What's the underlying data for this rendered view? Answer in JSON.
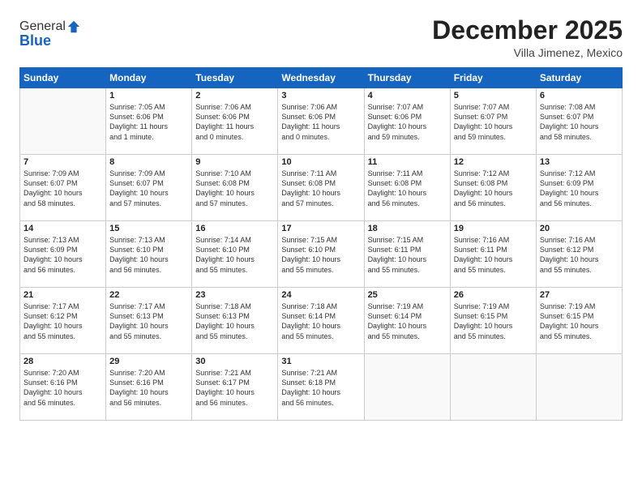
{
  "logo": {
    "general": "General",
    "blue": "Blue"
  },
  "header": {
    "month": "December 2025",
    "location": "Villa Jimenez, Mexico"
  },
  "weekdays": [
    "Sunday",
    "Monday",
    "Tuesday",
    "Wednesday",
    "Thursday",
    "Friday",
    "Saturday"
  ],
  "weeks": [
    [
      {
        "day": "",
        "info": ""
      },
      {
        "day": "1",
        "info": "Sunrise: 7:05 AM\nSunset: 6:06 PM\nDaylight: 11 hours\nand 1 minute."
      },
      {
        "day": "2",
        "info": "Sunrise: 7:06 AM\nSunset: 6:06 PM\nDaylight: 11 hours\nand 0 minutes."
      },
      {
        "day": "3",
        "info": "Sunrise: 7:06 AM\nSunset: 6:06 PM\nDaylight: 11 hours\nand 0 minutes."
      },
      {
        "day": "4",
        "info": "Sunrise: 7:07 AM\nSunset: 6:06 PM\nDaylight: 10 hours\nand 59 minutes."
      },
      {
        "day": "5",
        "info": "Sunrise: 7:07 AM\nSunset: 6:07 PM\nDaylight: 10 hours\nand 59 minutes."
      },
      {
        "day": "6",
        "info": "Sunrise: 7:08 AM\nSunset: 6:07 PM\nDaylight: 10 hours\nand 58 minutes."
      }
    ],
    [
      {
        "day": "7",
        "info": "Sunrise: 7:09 AM\nSunset: 6:07 PM\nDaylight: 10 hours\nand 58 minutes."
      },
      {
        "day": "8",
        "info": "Sunrise: 7:09 AM\nSunset: 6:07 PM\nDaylight: 10 hours\nand 57 minutes."
      },
      {
        "day": "9",
        "info": "Sunrise: 7:10 AM\nSunset: 6:08 PM\nDaylight: 10 hours\nand 57 minutes."
      },
      {
        "day": "10",
        "info": "Sunrise: 7:11 AM\nSunset: 6:08 PM\nDaylight: 10 hours\nand 57 minutes."
      },
      {
        "day": "11",
        "info": "Sunrise: 7:11 AM\nSunset: 6:08 PM\nDaylight: 10 hours\nand 56 minutes."
      },
      {
        "day": "12",
        "info": "Sunrise: 7:12 AM\nSunset: 6:08 PM\nDaylight: 10 hours\nand 56 minutes."
      },
      {
        "day": "13",
        "info": "Sunrise: 7:12 AM\nSunset: 6:09 PM\nDaylight: 10 hours\nand 56 minutes."
      }
    ],
    [
      {
        "day": "14",
        "info": "Sunrise: 7:13 AM\nSunset: 6:09 PM\nDaylight: 10 hours\nand 56 minutes."
      },
      {
        "day": "15",
        "info": "Sunrise: 7:13 AM\nSunset: 6:10 PM\nDaylight: 10 hours\nand 56 minutes."
      },
      {
        "day": "16",
        "info": "Sunrise: 7:14 AM\nSunset: 6:10 PM\nDaylight: 10 hours\nand 55 minutes."
      },
      {
        "day": "17",
        "info": "Sunrise: 7:15 AM\nSunset: 6:10 PM\nDaylight: 10 hours\nand 55 minutes."
      },
      {
        "day": "18",
        "info": "Sunrise: 7:15 AM\nSunset: 6:11 PM\nDaylight: 10 hours\nand 55 minutes."
      },
      {
        "day": "19",
        "info": "Sunrise: 7:16 AM\nSunset: 6:11 PM\nDaylight: 10 hours\nand 55 minutes."
      },
      {
        "day": "20",
        "info": "Sunrise: 7:16 AM\nSunset: 6:12 PM\nDaylight: 10 hours\nand 55 minutes."
      }
    ],
    [
      {
        "day": "21",
        "info": "Sunrise: 7:17 AM\nSunset: 6:12 PM\nDaylight: 10 hours\nand 55 minutes."
      },
      {
        "day": "22",
        "info": "Sunrise: 7:17 AM\nSunset: 6:13 PM\nDaylight: 10 hours\nand 55 minutes."
      },
      {
        "day": "23",
        "info": "Sunrise: 7:18 AM\nSunset: 6:13 PM\nDaylight: 10 hours\nand 55 minutes."
      },
      {
        "day": "24",
        "info": "Sunrise: 7:18 AM\nSunset: 6:14 PM\nDaylight: 10 hours\nand 55 minutes."
      },
      {
        "day": "25",
        "info": "Sunrise: 7:19 AM\nSunset: 6:14 PM\nDaylight: 10 hours\nand 55 minutes."
      },
      {
        "day": "26",
        "info": "Sunrise: 7:19 AM\nSunset: 6:15 PM\nDaylight: 10 hours\nand 55 minutes."
      },
      {
        "day": "27",
        "info": "Sunrise: 7:19 AM\nSunset: 6:15 PM\nDaylight: 10 hours\nand 55 minutes."
      }
    ],
    [
      {
        "day": "28",
        "info": "Sunrise: 7:20 AM\nSunset: 6:16 PM\nDaylight: 10 hours\nand 56 minutes."
      },
      {
        "day": "29",
        "info": "Sunrise: 7:20 AM\nSunset: 6:16 PM\nDaylight: 10 hours\nand 56 minutes."
      },
      {
        "day": "30",
        "info": "Sunrise: 7:21 AM\nSunset: 6:17 PM\nDaylight: 10 hours\nand 56 minutes."
      },
      {
        "day": "31",
        "info": "Sunrise: 7:21 AM\nSunset: 6:18 PM\nDaylight: 10 hours\nand 56 minutes."
      },
      {
        "day": "",
        "info": ""
      },
      {
        "day": "",
        "info": ""
      },
      {
        "day": "",
        "info": ""
      }
    ]
  ]
}
